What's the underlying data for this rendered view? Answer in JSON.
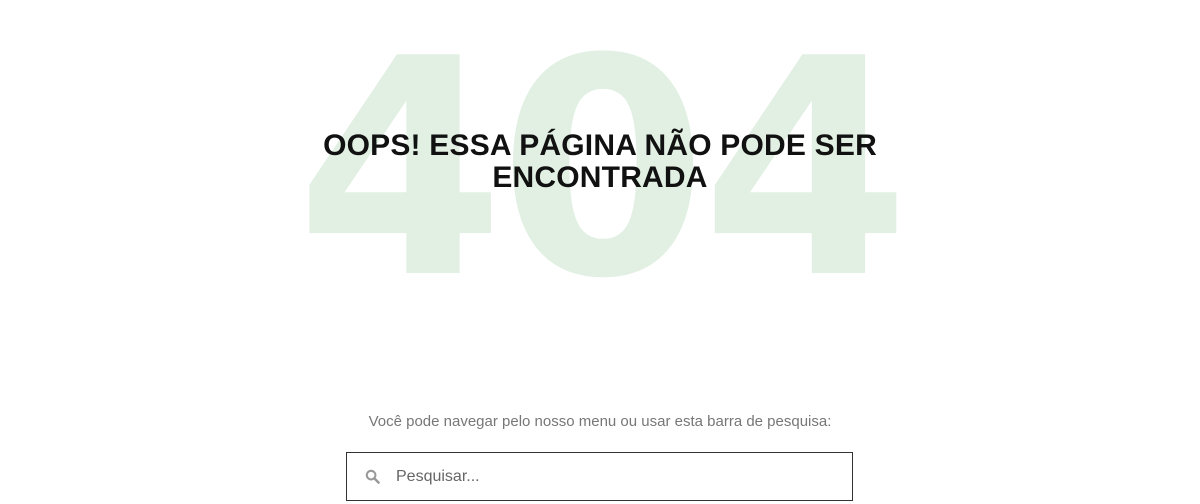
{
  "error": {
    "code": "404",
    "title": "OOPS! ESSA PÁGINA NÃO PODE SER ENCONTRADA"
  },
  "search": {
    "hint": "Você pode navegar pelo nosso menu ou usar esta barra de pesquisa:",
    "placeholder": "Pesquisar...",
    "value": "",
    "icon": "search-icon"
  },
  "colors": {
    "background": "#ffffff",
    "code_watermark": "#e1f0e3",
    "title": "#111111",
    "hint": "#777777",
    "input_border": "#333333"
  }
}
